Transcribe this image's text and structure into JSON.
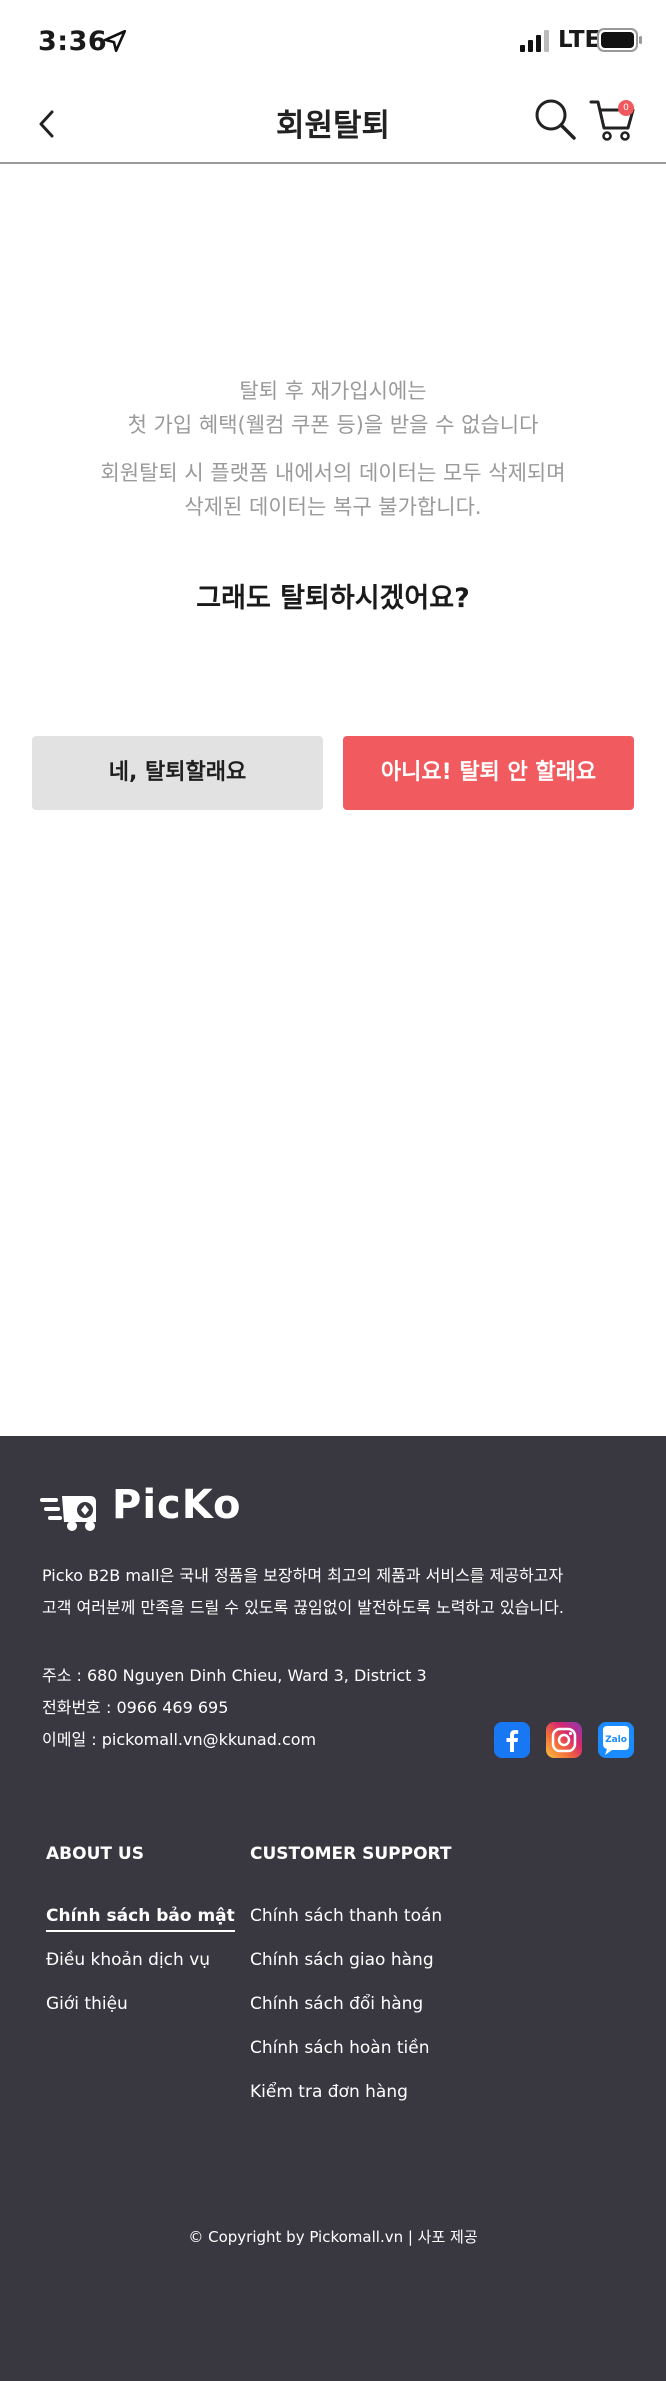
{
  "status_bar": {
    "time": "3:36",
    "network": "LTE"
  },
  "header": {
    "title": "회원탈퇴",
    "cart_count": "0"
  },
  "main": {
    "notice1_line1": "탈퇴 후 재가입시에는",
    "notice1_line2": "첫 가입 혜택(웰컴 쿠폰 등)을 받을 수 없습니다",
    "notice2_line1": "회원탈퇴 시 플랫폼 내에서의 데이터는 모두 삭제되며",
    "notice2_line2": "삭제된 데이터는 복구 불가합니다.",
    "question": "그래도 탈퇴하시겠어요?",
    "yes_label": "네, 탈퇴할래요",
    "no_label": "아니요! 탈퇴 안 할래요"
  },
  "footer": {
    "brand": "PicKo",
    "desc_line1": "Picko B2B mall은 국내 정품을 보장하며 최고의 제품과 서비스를 제공하고자",
    "desc_line2": "고객 여러분께 만족을 드릴 수 있도록 끊임없이 발전하도록 노력하고 있습니다.",
    "address": "주소 : 680 Nguyen Dinh Chieu, Ward 3, District 3",
    "phone": "전화번호 : 0966 469 695",
    "email": "이메일 : pickomall.vn@kkunad.com",
    "social": {
      "zalo": "Zalo"
    },
    "about_title": "ABOUT US",
    "about_links": [
      "Chính sách bảo mật",
      "Điều khoản dịch vụ",
      "Giới thiệu"
    ],
    "support_title": "CUSTOMER SUPPORT",
    "support_links": [
      "Chính sách thanh toán",
      "Chính sách giao hàng",
      "Chính sách đổi hàng",
      "Chính sách hoàn tiền",
      "Kiểm tra đơn hàng"
    ],
    "copyright": "© Copyright by Pickomall.vn | 사포 제공"
  },
  "colors": {
    "accent": "#f15a5f",
    "footer_bg": "#393841",
    "secondary_button": "#e2e2e2",
    "muted_text": "#9a9a9a"
  }
}
